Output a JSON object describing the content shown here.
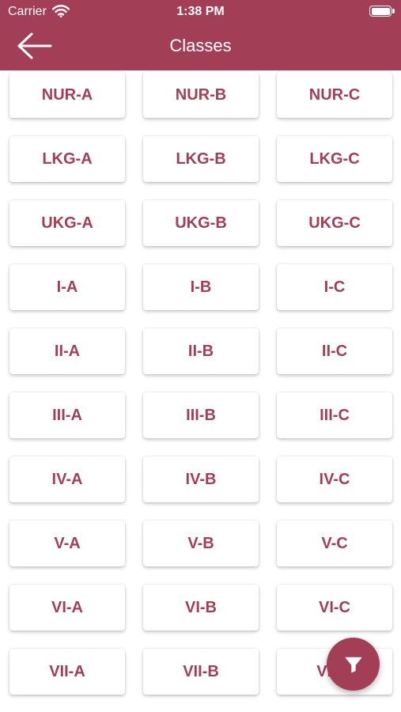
{
  "status_bar": {
    "carrier": "Carrier",
    "time": "1:38 PM"
  },
  "header": {
    "title": "Classes",
    "back_icon": "arrow-left-icon"
  },
  "fab": {
    "icon": "filter-icon"
  },
  "colors": {
    "primary": "#a23f57",
    "text_on_primary": "#ffffff",
    "card_bg": "#ffffff"
  },
  "classes": [
    [
      "NUR-A",
      "NUR-B",
      "NUR-C"
    ],
    [
      "LKG-A",
      "LKG-B",
      "LKG-C"
    ],
    [
      "UKG-A",
      "UKG-B",
      "UKG-C"
    ],
    [
      "I-A",
      "I-B",
      "I-C"
    ],
    [
      "II-A",
      "II-B",
      "II-C"
    ],
    [
      "III-A",
      "III-B",
      "III-C"
    ],
    [
      "IV-A",
      "IV-B",
      "IV-C"
    ],
    [
      "V-A",
      "V-B",
      "V-C"
    ],
    [
      "VI-A",
      "VI-B",
      "VI-C"
    ],
    [
      "VII-A",
      "VII-B",
      "VII-C"
    ]
  ]
}
